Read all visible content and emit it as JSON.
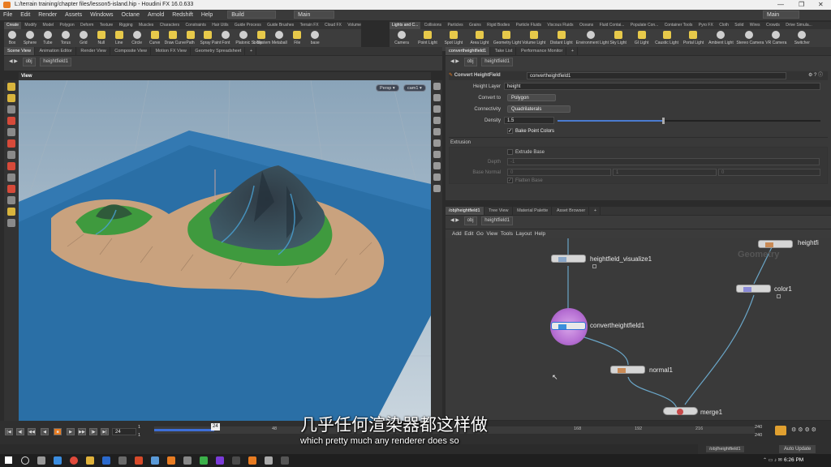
{
  "window": {
    "title": "L:/terrain training/chapter files/lesson5-island.hip - Houdini FX 16.0.633",
    "controls": [
      "—",
      "❐",
      "✕"
    ]
  },
  "menubar": {
    "items": [
      "File",
      "Edit",
      "Render",
      "Assets",
      "Windows",
      "Octane",
      "Arnold",
      "Redshift",
      "Help"
    ],
    "desktop": "Build",
    "desktop_main": "Main",
    "right_main": "Main"
  },
  "shelf_left": {
    "tabs": [
      "Create",
      "Modify",
      "Model",
      "Polygon",
      "Deform",
      "Texture",
      "Rigging",
      "Muscles",
      "Characters",
      "Constraints",
      "Hair Utils",
      "Guide Process",
      "Guide Brushes",
      "Terrain FX",
      "Cloud FX",
      "Volume"
    ],
    "tools": [
      "Box",
      "Sphere",
      "Tube",
      "Torus",
      "Grid",
      "Null",
      "Line",
      "Circle",
      "Curve",
      "Draw Curve",
      "Path",
      "Spray Paint",
      "Font",
      "Platonic Solids",
      "L-System",
      "Metaball",
      "File",
      "base"
    ]
  },
  "shelf_right": {
    "tabs": [
      "Lights and C...",
      "Collisions",
      "Particles",
      "Grains",
      "Rigid Bodies",
      "Particle Fluids",
      "Viscous Fluids",
      "Oceans",
      "Fluid Contai...",
      "Populate Con...",
      "Container Tools",
      "Pyro FX",
      "Cloth",
      "Solid",
      "Wires",
      "Crowds",
      "Drive Simula..."
    ],
    "tools": [
      "Camera",
      "Point Light",
      "Spot Light",
      "Area Light",
      "Geometry Light",
      "Volume Light",
      "Distant Light",
      "Environment Light",
      "Sky Light",
      "GI Light",
      "Caustic Light",
      "Portal Light",
      "Ambient Light",
      "Stereo Camera",
      "VR Camera",
      "Switcher"
    ]
  },
  "left_pane": {
    "tabs": [
      "Scene View",
      "Animation Editor",
      "Render View",
      "Composite View",
      "Motion FX View",
      "Geometry Spreadsheet"
    ],
    "path": [
      "obj",
      "heightfield1"
    ],
    "view_label": "View",
    "persp": "Persp ▾",
    "camera": "cam1 ▾"
  },
  "param_pane": {
    "tabs": [
      "convertheightfield1",
      "Take List",
      "Performance Monitor"
    ],
    "path": [
      "obj",
      "heightfield1"
    ],
    "node_type": "Convert HeightField",
    "node_name": "convertheightfield1",
    "height_layer_label": "Height Layer",
    "height_layer": "height",
    "convert_to_label": "Convert to",
    "convert_to": "Polygon",
    "connectivity_label": "Connectivity",
    "connectivity": "Quadrilaterals",
    "density_label": "Density",
    "density": "1.5",
    "density_fraction": 0.4,
    "bake_point_colors": "Bake Point Colors",
    "extrusion_label": "Extrusion",
    "extrude_base": "Extrude Base",
    "depth_label": "Depth",
    "depth": "-1",
    "base_normal_label": "Base Normal",
    "base_normal": [
      "0",
      "1",
      "0"
    ],
    "flatten_base": "Flatten Base"
  },
  "network_pane": {
    "tabs": [
      "/obj/heightfield1",
      "Tree View",
      "Material Palette",
      "Asset Browser"
    ],
    "path": [
      "obj",
      "heightfield1"
    ],
    "menu": [
      "Add",
      "Edit",
      "Go",
      "View",
      "Tools",
      "Layout",
      "Help"
    ],
    "context": "Geometry",
    "nodes": [
      "heightfield_visualize1",
      "convertheightfield1",
      "normal1",
      "merge1",
      "color1",
      "heightfi"
    ]
  },
  "timeline": {
    "current_frame": "24",
    "start": "1",
    "start2": "1",
    "marker": "24",
    "ticks": [
      "48",
      "168",
      "192",
      "216"
    ],
    "end": "240",
    "end2": "240",
    "playhead_fraction": 0.1
  },
  "statusbar": {
    "path": "/obj/heightfield1",
    "auto_update": "Auto Update"
  },
  "subtitles": {
    "chinese": "几乎任何渲染器都这样做",
    "english": "which pretty much any renderer does so"
  },
  "taskbar": {
    "time": "6:26 PM"
  },
  "colors": {
    "ocean": "#2a6fa6",
    "sand": "#c9a27e",
    "grass": "#3f9a3e",
    "rock": "#3a4654",
    "selected_node": "#c07ad8",
    "accent_orange": "#e87c22"
  }
}
